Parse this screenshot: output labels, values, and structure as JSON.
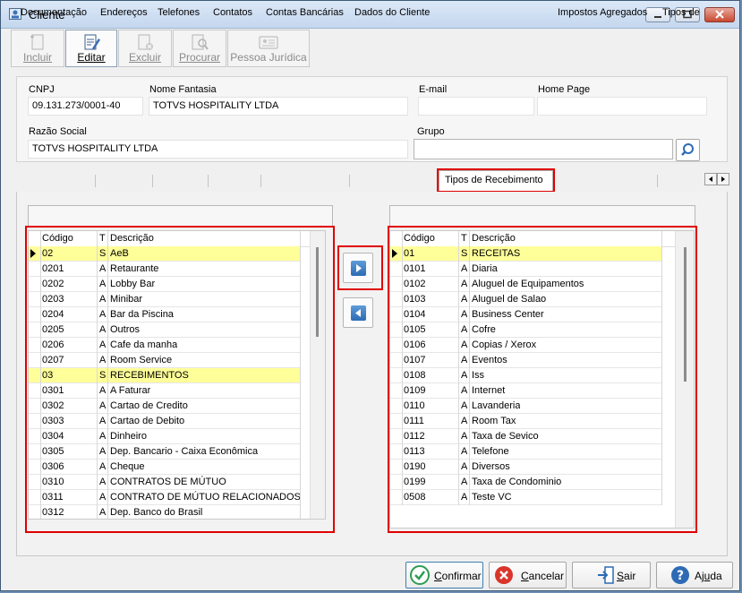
{
  "window": {
    "title": "Cliente"
  },
  "toolbar": {
    "incluir": "Incluir",
    "editar": "Editar",
    "excluir": "Excluir",
    "procurar": "Procurar",
    "pessoa_juridica": "Pessoa Jurídica"
  },
  "form": {
    "cnpj_label": "CNPJ",
    "cnpj": "09.131.273/0001-40",
    "nome_fantasia_label": "Nome Fantasia",
    "nome_fantasia": "TOTVS HOSPITALITY LTDA",
    "email_label": "E-mail",
    "email": "",
    "home_page_label": "Home Page",
    "home_page": "",
    "razao_social_label": "Razão Social",
    "razao_social": "TOTVS HOSPITALITY LTDA",
    "grupo_label": "Grupo",
    "grupo": ""
  },
  "tabs": [
    "Documentação",
    "Endereços",
    "Telefones",
    "Contatos",
    "Contas Bancárias",
    "Dados do Cliente",
    "Tipos de Recebimento",
    "Impostos Agregados",
    "Tipos de"
  ],
  "left_grid": {
    "headers": {
      "codigo": "Código",
      "t": "T",
      "descricao": "Descrição"
    },
    "rows": [
      {
        "codigo": "02",
        "t": "S",
        "descricao": "AeB"
      },
      {
        "codigo": "0201",
        "t": "A",
        "descricao": "Retaurante"
      },
      {
        "codigo": "0202",
        "t": "A",
        "descricao": "Lobby Bar"
      },
      {
        "codigo": "0203",
        "t": "A",
        "descricao": "Minibar"
      },
      {
        "codigo": "0204",
        "t": "A",
        "descricao": "Bar da Piscina"
      },
      {
        "codigo": "0205",
        "t": "A",
        "descricao": "Outros"
      },
      {
        "codigo": "0206",
        "t": "A",
        "descricao": "Cafe da manha"
      },
      {
        "codigo": "0207",
        "t": "A",
        "descricao": "Room Service"
      },
      {
        "codigo": "03",
        "t": "S",
        "descricao": "RECEBIMENTOS"
      },
      {
        "codigo": "0301",
        "t": "A",
        "descricao": "A Faturar"
      },
      {
        "codigo": "0302",
        "t": "A",
        "descricao": "Cartao de Credito"
      },
      {
        "codigo": "0303",
        "t": "A",
        "descricao": "Cartao de Debito"
      },
      {
        "codigo": "0304",
        "t": "A",
        "descricao": "Dinheiro"
      },
      {
        "codigo": "0305",
        "t": "A",
        "descricao": "Dep. Bancario - Caixa Econômica"
      },
      {
        "codigo": "0306",
        "t": "A",
        "descricao": "Cheque"
      },
      {
        "codigo": "0310",
        "t": "A",
        "descricao": "CONTRATOS DE MÚTUO"
      },
      {
        "codigo": "0311",
        "t": "A",
        "descricao": "CONTRATO DE MÚTUO RELACIONADOS"
      },
      {
        "codigo": "0312",
        "t": "A",
        "descricao": "Dep. Banco do Brasil"
      }
    ]
  },
  "right_grid": {
    "headers": {
      "codigo": "Código",
      "t": "T",
      "descricao": "Descrição"
    },
    "rows": [
      {
        "codigo": "01",
        "t": "S",
        "descricao": "RECEITAS"
      },
      {
        "codigo": "0101",
        "t": "A",
        "descricao": "Diaria"
      },
      {
        "codigo": "0102",
        "t": "A",
        "descricao": "Aluguel de Equipamentos"
      },
      {
        "codigo": "0103",
        "t": "A",
        "descricao": "Aluguel de Salao"
      },
      {
        "codigo": "0104",
        "t": "A",
        "descricao": "Business Center"
      },
      {
        "codigo": "0105",
        "t": "A",
        "descricao": "Cofre"
      },
      {
        "codigo": "0106",
        "t": "A",
        "descricao": "Copias / Xerox"
      },
      {
        "codigo": "0107",
        "t": "A",
        "descricao": "Eventos"
      },
      {
        "codigo": "0108",
        "t": "A",
        "descricao": "Iss"
      },
      {
        "codigo": "0109",
        "t": "A",
        "descricao": "Internet"
      },
      {
        "codigo": "0110",
        "t": "A",
        "descricao": "Lavanderia"
      },
      {
        "codigo": "0111",
        "t": "A",
        "descricao": "Room Tax"
      },
      {
        "codigo": "0112",
        "t": "A",
        "descricao": "Taxa de Sevico"
      },
      {
        "codigo": "0113",
        "t": "A",
        "descricao": "Telefone"
      },
      {
        "codigo": "0190",
        "t": "A",
        "descricao": "Diversos"
      },
      {
        "codigo": "0199",
        "t": "A",
        "descricao": "Taxa de Condominio"
      },
      {
        "codigo": "0508",
        "t": "A",
        "descricao": "Teste VC"
      }
    ]
  },
  "footer": {
    "confirmar_u": "C",
    "confirmar_rest": "onfirmar",
    "cancelar_u": "C",
    "cancelar_rest": "ancelar",
    "sair_u": "S",
    "sair_rest": "air",
    "ajuda_pre": "Aj",
    "ajuda_u": "u",
    "ajuda_rest": "da"
  },
  "colors": {
    "highlight_row": "#ffff99",
    "annotation_red": "#e00000",
    "accent_blue": "#2d6bb5"
  }
}
